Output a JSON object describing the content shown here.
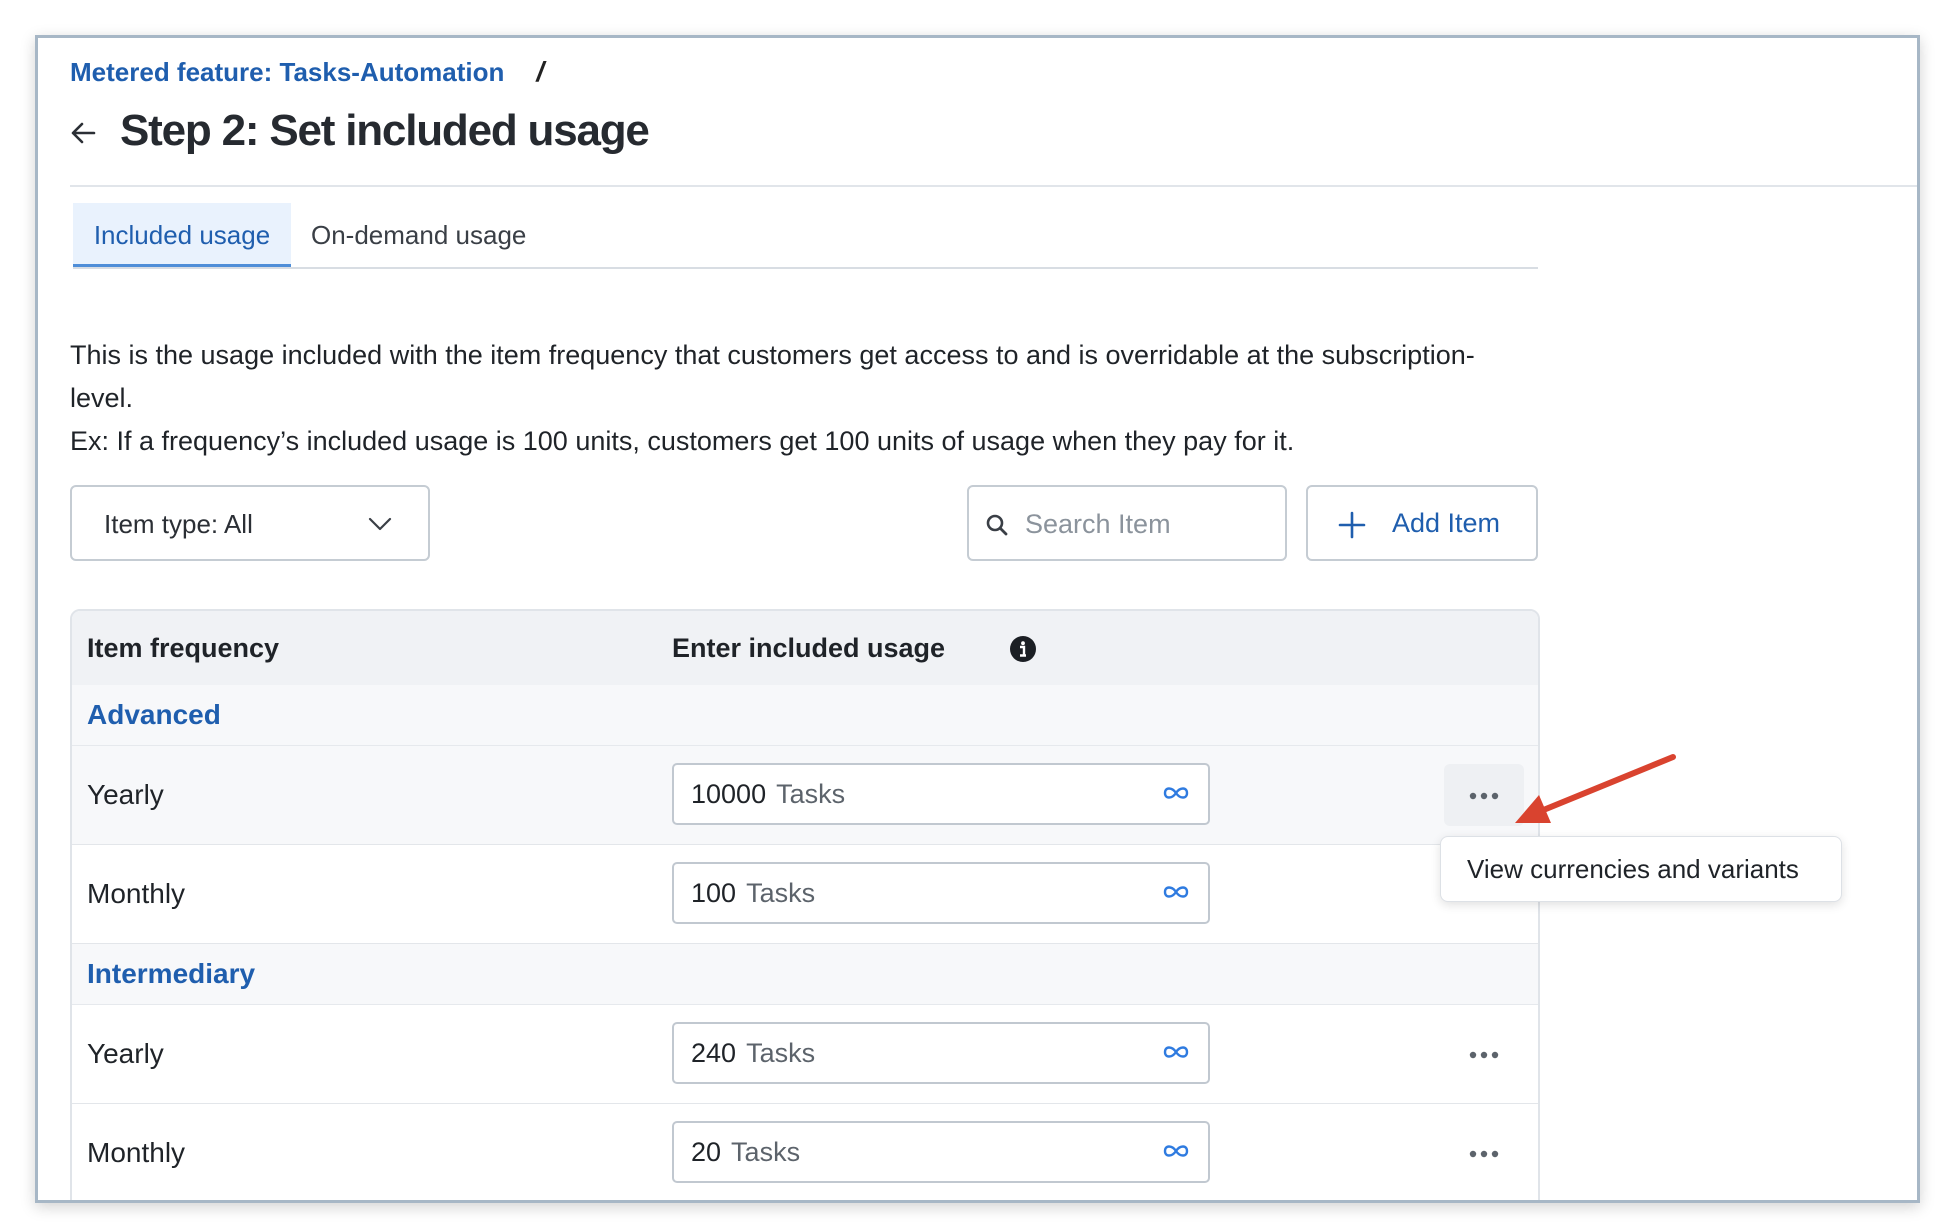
{
  "breadcrumb": {
    "link": "Metered feature: Tasks-Automation",
    "separator": "/"
  },
  "page_title": "Step 2: Set included usage",
  "tabs": [
    {
      "label": "Included usage",
      "active": true
    },
    {
      "label": "On-demand usage",
      "active": false
    }
  ],
  "description": {
    "line1": "This is the usage included with the item frequency that customers get access to and is overridable at the subscription-level.",
    "line2": "Ex: If a frequency’s included usage is 100 units, customers get 100 units of usage when they pay for it."
  },
  "toolbar": {
    "filter_label": "Item type: All",
    "search_placeholder": "Search Item",
    "add_label": "Add Item"
  },
  "table": {
    "headers": {
      "frequency": "Item frequency",
      "usage": "Enter included usage"
    },
    "groups": [
      {
        "name": "Advanced",
        "rows": [
          {
            "frequency": "Yearly",
            "value": "10000",
            "unit": "Tasks"
          },
          {
            "frequency": "Monthly",
            "value": "100",
            "unit": "Tasks"
          }
        ]
      },
      {
        "name": "Intermediary",
        "rows": [
          {
            "frequency": "Yearly",
            "value": "240",
            "unit": "Tasks"
          },
          {
            "frequency": "Monthly",
            "value": "20",
            "unit": "Tasks"
          }
        ]
      }
    ]
  },
  "tooltip": "View currencies and variants",
  "colors": {
    "accent": "#1f5eae",
    "annotation_arrow": "#d9432f",
    "tab_active_bg": "#e9f2fd"
  }
}
